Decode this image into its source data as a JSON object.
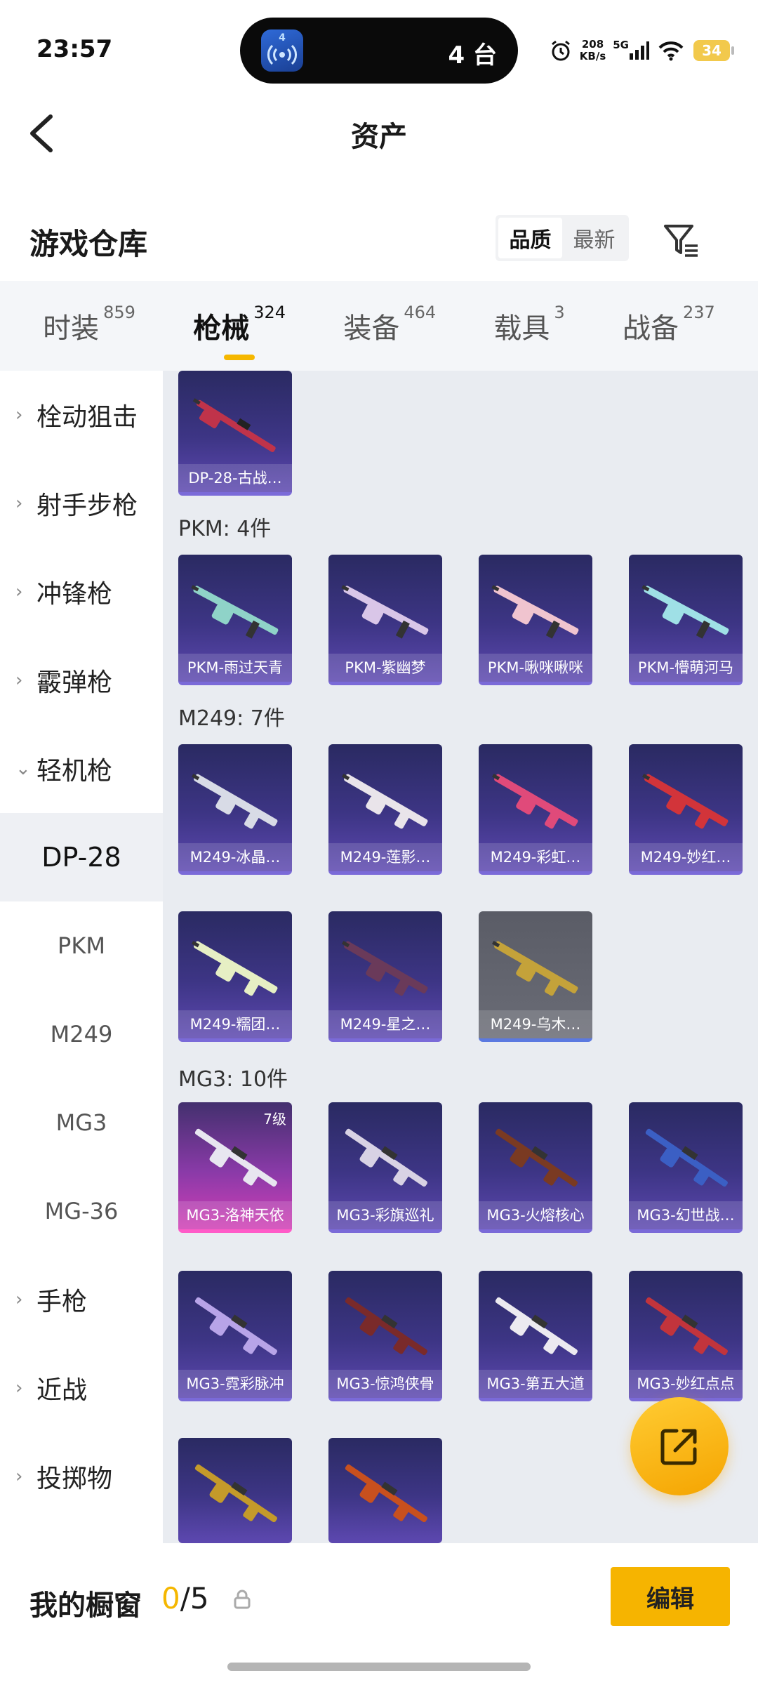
{
  "status_bar": {
    "time": "23:57",
    "island_app_badge": "4",
    "island_count": "4 台",
    "net_speed_value": "208",
    "net_speed_unit": "KB/s",
    "network": "5G",
    "battery": "34"
  },
  "header": {
    "title": "资产"
  },
  "section": {
    "title": "游戏仓库",
    "sort_options": [
      "品质",
      "最新"
    ],
    "sort_selected": "品质"
  },
  "tabs": [
    {
      "label": "时装",
      "count": "859",
      "active": false
    },
    {
      "label": "枪械",
      "count": "324",
      "active": true
    },
    {
      "label": "装备",
      "count": "464",
      "active": false
    },
    {
      "label": "载具",
      "count": "3",
      "active": false
    },
    {
      "label": "战备",
      "count": "237",
      "active": false
    }
  ],
  "sidebar": {
    "items": [
      {
        "label": "栓动狙击",
        "kind": "group",
        "expanded": false
      },
      {
        "label": "射手步枪",
        "kind": "group",
        "expanded": false
      },
      {
        "label": "冲锋枪",
        "kind": "group",
        "expanded": false
      },
      {
        "label": "霰弹枪",
        "kind": "group",
        "expanded": false
      },
      {
        "label": "轻机枪",
        "kind": "group",
        "expanded": true
      },
      {
        "label": "DP-28",
        "kind": "sub",
        "active": true
      },
      {
        "label": "PKM",
        "kind": "sub",
        "active": false
      },
      {
        "label": "M249",
        "kind": "sub",
        "active": false
      },
      {
        "label": "MG3",
        "kind": "sub",
        "active": false
      },
      {
        "label": "MG-36",
        "kind": "sub",
        "active": false
      },
      {
        "label": "手枪",
        "kind": "group",
        "expanded": false
      },
      {
        "label": "近战",
        "kind": "group",
        "expanded": false
      },
      {
        "label": "投掷物",
        "kind": "group",
        "expanded": false
      }
    ]
  },
  "groups": [
    {
      "title": "",
      "items": [
        {
          "name": "DP-28-古战…",
          "style": "purple"
        }
      ]
    },
    {
      "title": "PKM: 4件",
      "items": [
        {
          "name": "PKM-雨过天青",
          "style": "purple"
        },
        {
          "name": "PKM-紫幽梦",
          "style": "purple"
        },
        {
          "name": "PKM-啾咪啾咪",
          "style": "purple"
        },
        {
          "name": "PKM-懵萌河马",
          "style": "purple"
        }
      ]
    },
    {
      "title": "M249: 7件",
      "items": [
        {
          "name": "M249-冰晶…",
          "style": "purple"
        },
        {
          "name": "M249-莲影…",
          "style": "purple"
        },
        {
          "name": "M249-彩虹…",
          "style": "purple"
        },
        {
          "name": "M249-妙红…",
          "style": "purple"
        },
        {
          "name": "M249-糯团…",
          "style": "purple"
        },
        {
          "name": "M249-星之…",
          "style": "purple"
        },
        {
          "name": "M249-乌木…",
          "style": "gray"
        }
      ]
    },
    {
      "title": "MG3: 10件",
      "items": [
        {
          "name": "MG3-洛神天依",
          "style": "pink",
          "level": "7级"
        },
        {
          "name": "MG3-彩旗巡礼",
          "style": "purple"
        },
        {
          "name": "MG3-火熔核心",
          "style": "purple"
        },
        {
          "name": "MG3-幻世战…",
          "style": "purple"
        },
        {
          "name": "MG3-霓彩脉冲",
          "style": "purple"
        },
        {
          "name": "MG3-惊鸿侠骨",
          "style": "purple"
        },
        {
          "name": "MG3-第五大道",
          "style": "purple"
        },
        {
          "name": "MG3-妙红点点",
          "style": "purple"
        },
        {
          "name": "",
          "style": "purple"
        },
        {
          "name": "",
          "style": "purple"
        }
      ]
    }
  ],
  "gun_colors": [
    "#c0334a",
    "#8fd3c8",
    "#d9c6e8",
    "#f0c4cf",
    "#9fe0e6",
    "#d8dbe6",
    "#e9e4ea",
    "#e04a7a",
    "#d2343a",
    "#e6efc4",
    "#6a3a5a",
    "#c4a23a",
    "#e8e6f0",
    "#d8d2e4",
    "#7a3a22",
    "#3b5fc4",
    "#b8a4e8",
    "#7a2a2a",
    "#eceaf0",
    "#c2343c",
    "#c49a2a",
    "#c8501e"
  ],
  "footer": {
    "showcase_title": "我的橱窗",
    "showcase_used": "0",
    "showcase_total": "/5",
    "edit_label": "编辑"
  }
}
